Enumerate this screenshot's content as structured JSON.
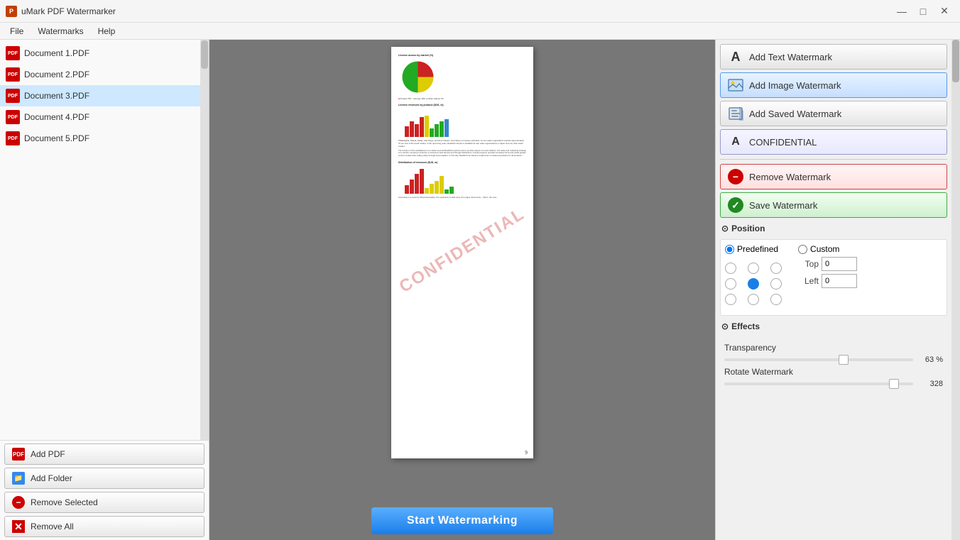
{
  "app": {
    "title": "uMark PDF Watermarker",
    "icon": "pdf-icon"
  },
  "window_controls": {
    "minimize": "—",
    "maximize": "□",
    "close": "✕"
  },
  "menu": {
    "items": [
      "File",
      "Watermarks",
      "Help"
    ]
  },
  "file_list": {
    "items": [
      {
        "name": "Document 1.PDF",
        "selected": false
      },
      {
        "name": "Document 2.PDF",
        "selected": false
      },
      {
        "name": "Document 3.PDF",
        "selected": true
      },
      {
        "name": "Document 4.PDF",
        "selected": false
      },
      {
        "name": "Document 5.PDF",
        "selected": false
      }
    ]
  },
  "left_buttons": {
    "add_pdf": "Add PDF",
    "add_folder": "Add Folder",
    "remove_selected": "Remove Selected",
    "remove_all": "Remove All"
  },
  "right_panel": {
    "add_text_watermark": "Add Text Watermark",
    "add_image_watermark": "Add Image Watermark",
    "add_saved_watermark": "Add Saved Watermark",
    "watermark_name": "CONFIDENTIAL",
    "remove_watermark": "Remove Watermark",
    "save_watermark": "Save Watermark"
  },
  "position": {
    "label": "Position",
    "predefined_label": "Predefined",
    "custom_label": "Custom",
    "top_label": "Top",
    "left_label": "Left",
    "top_value": "0",
    "left_value": "0",
    "selected_dot": 4
  },
  "effects": {
    "label": "Effects",
    "transparency_label": "Transparency",
    "transparency_value": "63 %",
    "transparency_pct": 63,
    "rotate_label": "Rotate Watermark",
    "rotate_value": "328",
    "rotate_pct": 90
  },
  "pdf_preview": {
    "watermark_text": "CONFIDENTIAL",
    "page_number": "9"
  },
  "start_button": {
    "label": "Start Watermarking"
  }
}
